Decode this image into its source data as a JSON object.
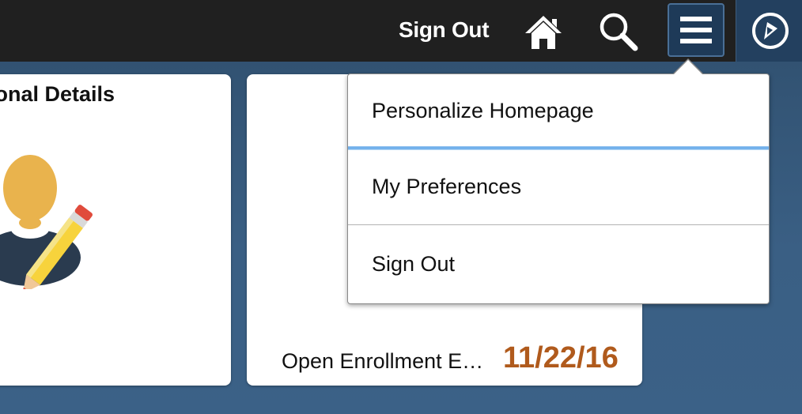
{
  "header": {
    "sign_out_label": "Sign Out",
    "icons": {
      "home": "home-icon",
      "search": "search-icon",
      "menu": "hamburger-menu-icon",
      "navbar": "compass-icon"
    }
  },
  "tiles": {
    "personal_details": {
      "title": "rsonal Details",
      "icon": "person-edit-icon"
    },
    "open_enrollment": {
      "label": "Open Enrollment E…",
      "date": "11/22/16"
    }
  },
  "actions_menu": {
    "items": [
      {
        "label": "Personalize Homepage"
      },
      {
        "label": "My Preferences"
      },
      {
        "label": "Sign Out"
      }
    ]
  },
  "colors": {
    "topbar": "#202020",
    "background": "#35587a",
    "date_accent": "#b05a1c",
    "focus_line": "#5ea6ea"
  }
}
